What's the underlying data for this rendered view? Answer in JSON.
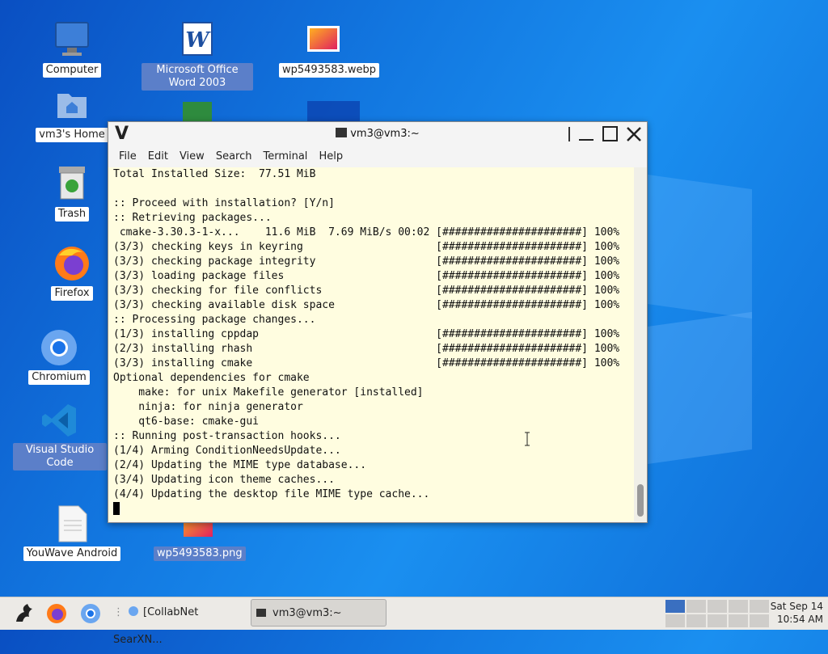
{
  "desktop": {
    "icons": [
      {
        "label": "Computer",
        "icon": "computer-icon"
      },
      {
        "label": "Microsoft Office Word 2003",
        "icon": "word-doc-icon"
      },
      {
        "label": "wp5493583.webp",
        "icon": "image-file-icon"
      },
      {
        "label": "vm3's Home",
        "icon": "home-folder-icon"
      },
      {
        "label": "Trash",
        "icon": "trash-icon"
      },
      {
        "label": "Firefox",
        "icon": "firefox-icon"
      },
      {
        "label": "Chromium",
        "icon": "chromium-icon"
      },
      {
        "label": "Visual Studio Code",
        "icon": "vscode-icon"
      },
      {
        "label": "YouWave Android",
        "icon": "text-file-icon"
      },
      {
        "label": "wp5493583.png",
        "icon": "image-file-icon"
      }
    ]
  },
  "terminal": {
    "title": "vm3@vm3:~",
    "menu": [
      "File",
      "Edit",
      "View",
      "Search",
      "Terminal",
      "Help"
    ],
    "lines": [
      "Total Installed Size:  77.51 MiB",
      "",
      ":: Proceed with installation? [Y/n]",
      ":: Retrieving packages...",
      " cmake-3.30.3-1-x...    11.6 MiB  7.69 MiB/s 00:02 [######################] 100%",
      "(3/3) checking keys in keyring                     [######################] 100%",
      "(3/3) checking package integrity                   [######################] 100%",
      "(3/3) loading package files                        [######################] 100%",
      "(3/3) checking for file conflicts                  [######################] 100%",
      "(3/3) checking available disk space                [######################] 100%",
      ":: Processing package changes...",
      "(1/3) installing cppdap                            [######################] 100%",
      "(2/3) installing rhash                             [######################] 100%",
      "(3/3) installing cmake                             [######################] 100%",
      "Optional dependencies for cmake",
      "    make: for unix Makefile generator [installed]",
      "    ninja: for ninja generator",
      "    qt6-base: cmake-gui",
      ":: Running post-transaction hooks...",
      "(1/4) Arming ConditionNeedsUpdate...",
      "(2/4) Updating the MIME type database...",
      "(3/4) Updating icon theme caches...",
      "(4/4) Updating the desktop file MIME type cache..."
    ]
  },
  "taskbar": {
    "browser_task": "[CollabNet SearXN...",
    "terminal_task": "vm3@vm3:~",
    "clock_date": "Sat Sep 14",
    "clock_time": "10:54 AM"
  },
  "colors": {
    "terminal_bg": "#fffde0",
    "desktop_accent": "#1277e0"
  }
}
